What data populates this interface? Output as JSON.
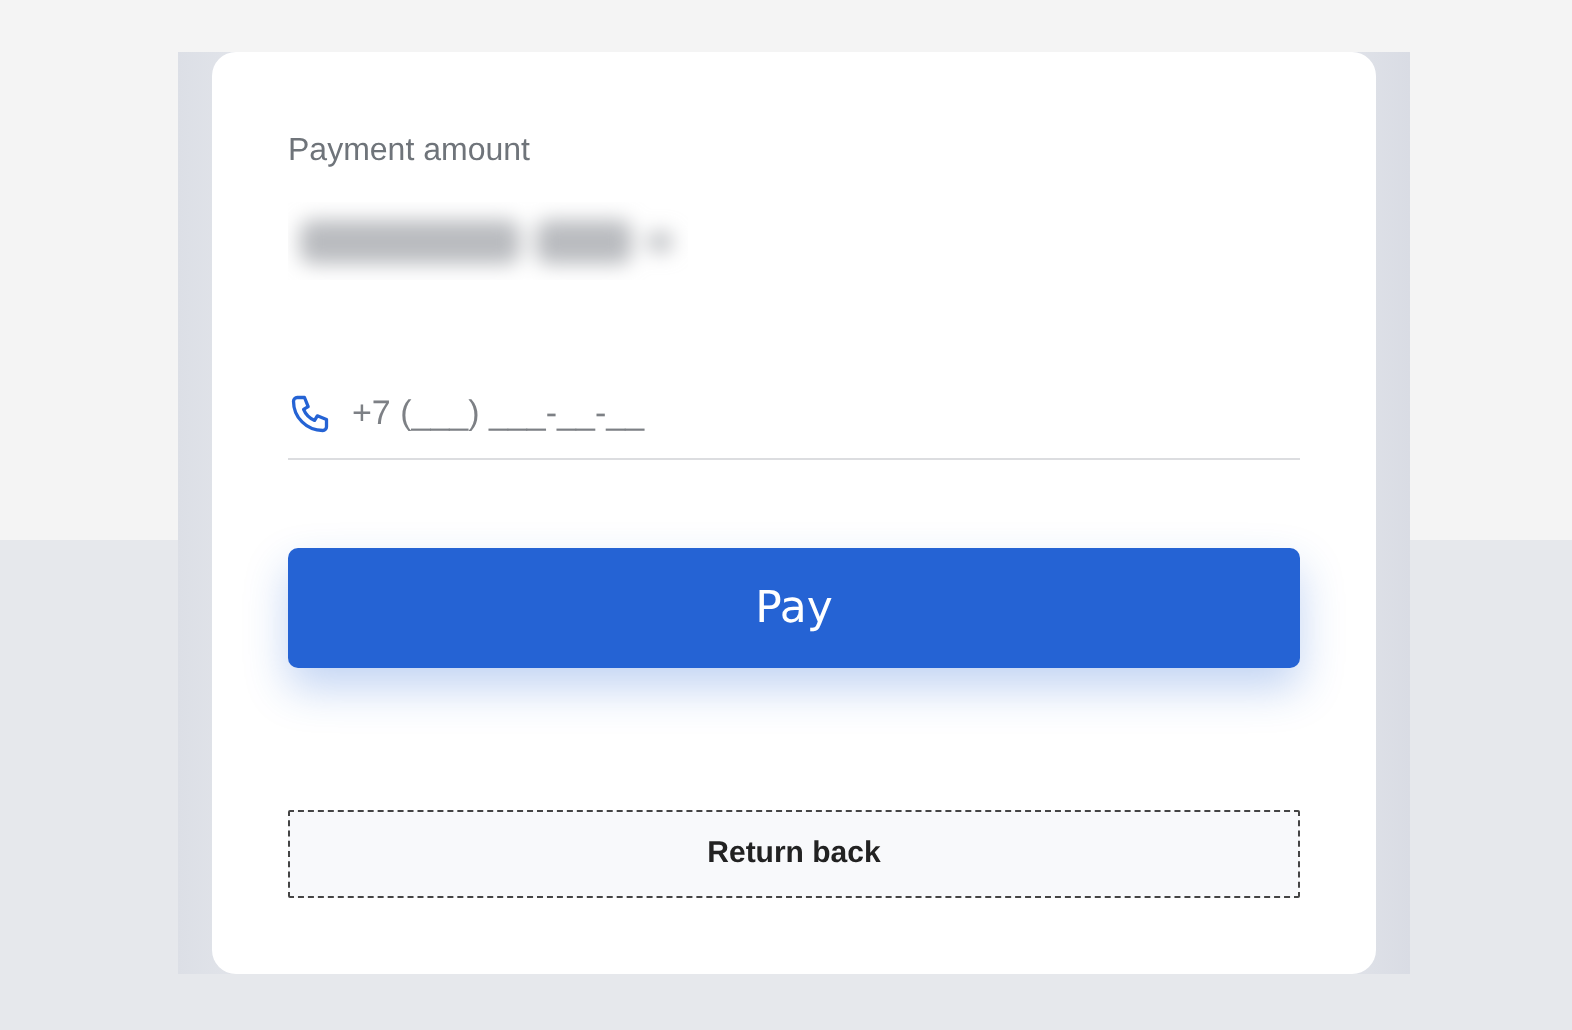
{
  "payment": {
    "label": "Payment amount",
    "amount_blurred": true
  },
  "phone": {
    "placeholder": "+7 (___) ___-__-__"
  },
  "buttons": [
    {
      "kind": "primary",
      "label": "Pay"
    },
    {
      "kind": "outline",
      "label": "Return back"
    }
  ]
}
